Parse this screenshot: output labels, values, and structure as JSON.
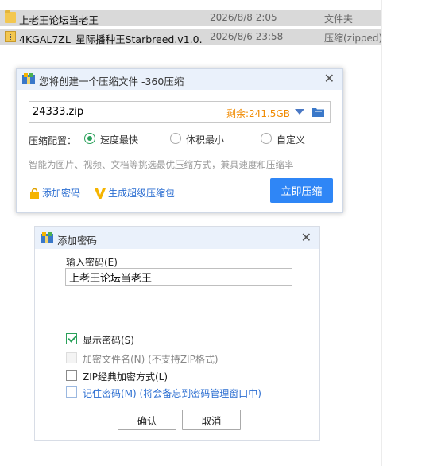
{
  "files": [
    {
      "name": "上老王论坛当老王",
      "date": "2026/8/8 2:05",
      "type": "文件夹",
      "icon": "folder-icon"
    },
    {
      "name": "4KGAL7ZL_星际播种王Starbreed.v1.0.2...",
      "date": "2026/8/6 23:58",
      "type": "压缩(zipped)",
      "icon": "zip-icon"
    }
  ],
  "compress_dialog": {
    "title": "您将创建一个压缩文件 -360压缩",
    "filename": "24333.zip",
    "free_space": "剩余:241.5GB",
    "config_label": "压缩配置：",
    "options": [
      {
        "label": "速度最快",
        "selected": true
      },
      {
        "label": "体积最小",
        "selected": false
      },
      {
        "label": "自定义",
        "selected": false
      }
    ],
    "hint": "智能为图片、视频、文档等挑选最优压缩方式，兼具速度和压缩率",
    "add_password": "添加密码",
    "super_pack": "生成超级压缩包",
    "compress_button": "立即压缩",
    "accent": "#2f86f6",
    "free_color": "#f08a00"
  },
  "password_dialog": {
    "title": "添加密码",
    "input_label": "输入密码(E)",
    "password_value": "上老王论坛当老王",
    "checkboxes": [
      {
        "label": "显示密码(S)",
        "checked": true,
        "disabled": false
      },
      {
        "label": "加密文件名(N) (不支持ZIP格式)",
        "checked": false,
        "disabled": true
      },
      {
        "label": "ZIP经典加密方式(L)",
        "checked": false,
        "disabled": false
      },
      {
        "label": "记住密码(M) (将会备忘到密码管理窗口中)",
        "checked": false,
        "disabled": false
      }
    ],
    "ok_button": "确认",
    "cancel_button": "取消"
  }
}
